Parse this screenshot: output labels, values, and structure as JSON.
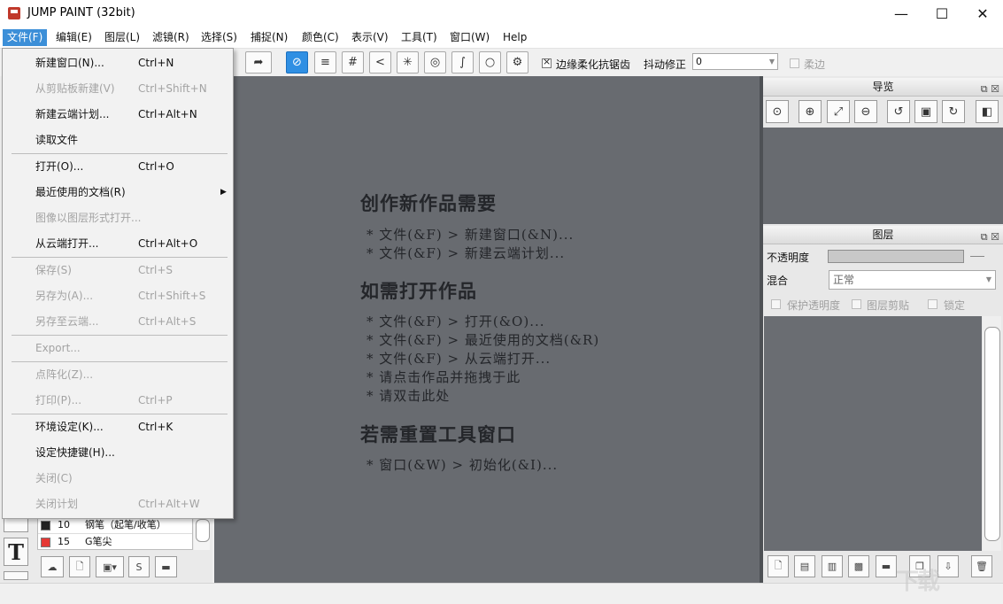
{
  "window": {
    "title": "JUMP PAINT (32bit)",
    "controls": {
      "minimize": "—",
      "maximize": "☐",
      "close": "✕"
    }
  },
  "menubar": {
    "items": [
      "文件(F)",
      "编辑(E)",
      "图层(L)",
      "滤镜(R)",
      "选择(S)",
      "捕捉(N)",
      "颜色(C)",
      "表示(V)",
      "工具(T)",
      "窗口(W)",
      "Help"
    ]
  },
  "toolbar": {
    "antialias_label": "边缘柔化抗锯齿",
    "jitter_label": "抖动修正",
    "jitter_value": "0",
    "soft_edge_label": "柔边"
  },
  "file_menu": {
    "items": [
      {
        "label": "新建窗口(N)...",
        "shortcut": "Ctrl+N",
        "enabled": true
      },
      {
        "label": "从剪贴板新建(V)",
        "shortcut": "Ctrl+Shift+N",
        "enabled": false
      },
      {
        "label": "新建云端计划...",
        "shortcut": "Ctrl+Alt+N",
        "enabled": true
      },
      {
        "label": "读取文件",
        "shortcut": "",
        "enabled": true
      },
      {
        "label": "打开(O)...",
        "shortcut": "Ctrl+O",
        "enabled": true
      },
      {
        "label": "最近使用的文档(R)",
        "shortcut": "",
        "enabled": true,
        "submenu": true
      },
      {
        "label": "图像以图层形式打开...",
        "shortcut": "",
        "enabled": false
      },
      {
        "label": "从云端打开...",
        "shortcut": "Ctrl+Alt+O",
        "enabled": true
      },
      {
        "label": "保存(S)",
        "shortcut": "Ctrl+S",
        "enabled": false
      },
      {
        "label": "另存为(A)...",
        "shortcut": "Ctrl+Shift+S",
        "enabled": false
      },
      {
        "label": "另存至云端...",
        "shortcut": "Ctrl+Alt+S",
        "enabled": false
      },
      {
        "label": "Export...",
        "shortcut": "",
        "enabled": false
      },
      {
        "label": "点阵化(Z)...",
        "shortcut": "",
        "enabled": false
      },
      {
        "label": "打印(P)...",
        "shortcut": "Ctrl+P",
        "enabled": false
      },
      {
        "label": "环境设定(K)...",
        "shortcut": "Ctrl+K",
        "enabled": true
      },
      {
        "label": "设定快捷键(H)...",
        "shortcut": "",
        "enabled": true
      },
      {
        "label": "关闭(C)",
        "shortcut": "",
        "enabled": false
      },
      {
        "label": "关闭计划",
        "shortcut": "Ctrl+Alt+W",
        "enabled": false
      }
    ]
  },
  "canvas_guide": {
    "sections": [
      {
        "heading": "创作新作品需要",
        "lines": [
          "* 文件(&F) > 新建窗口(&N)...",
          "* 文件(&F) > 新建云端计划..."
        ]
      },
      {
        "heading": "如需打开作品",
        "lines": [
          "* 文件(&F) > 打开(&O)...",
          "* 文件(&F) > 最近使用的文档(&R)",
          "* 文件(&F) > 从云端打开...",
          "* 请点击作品并拖拽于此",
          "* 请双击此处"
        ]
      },
      {
        "heading": "若需重置工具窗口",
        "lines": [
          "* 窗口(&W) > 初始化(&I)..."
        ]
      }
    ]
  },
  "navigator": {
    "title": "导览"
  },
  "layers": {
    "title": "图层",
    "opacity_label": "不透明度",
    "blend_label": "混合",
    "blend_value": "正常",
    "protect_alpha_label": "保护透明度",
    "clip_label": "图层剪贴",
    "lock_label": "锁定"
  },
  "brushes": [
    {
      "size": "10",
      "name": "钢笔（起笔/收笔）",
      "color": "#222222"
    },
    {
      "size": "15",
      "name": "G笔尖",
      "color": "#e53935"
    }
  ],
  "tool_letter": "T",
  "watermark": "下载"
}
